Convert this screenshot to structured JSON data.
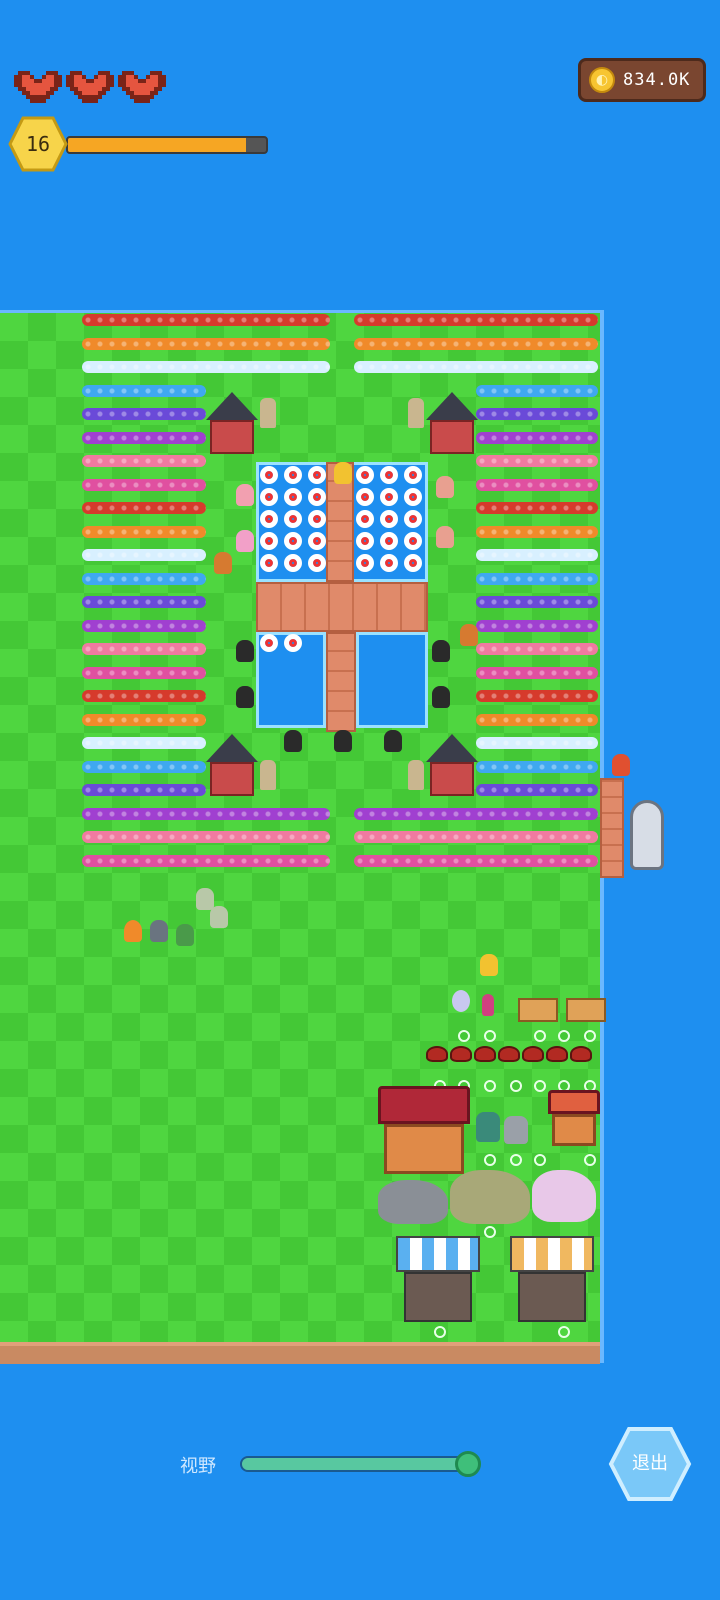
{
  "hud": {
    "hearts": [
      {
        "icon": "heart-icon",
        "state": "full"
      },
      {
        "icon": "heart-icon",
        "state": "full"
      },
      {
        "icon": "heart-icon",
        "state": "full"
      }
    ],
    "level": "16",
    "xp_progress_percent": 90,
    "coins": "834.0K",
    "colors": {
      "heart": "#e5553f",
      "xp": "#f6a623",
      "level_badge": "#f7d44a",
      "coin_panel": "#7a4630"
    }
  },
  "map": {
    "water_color": "#1e8ff0",
    "grass_color": "#4fd640",
    "flower_row_colors": [
      "#d63a2c",
      "#f08a2a",
      "#d8f0ff",
      "#3fa8f0",
      "#6a4ad8",
      "#a040d0",
      "#f07aa0",
      "#e050a0"
    ]
  },
  "controls": {
    "view_label": "视野",
    "view_zoom_percent": 95,
    "exit_label": "退出"
  }
}
